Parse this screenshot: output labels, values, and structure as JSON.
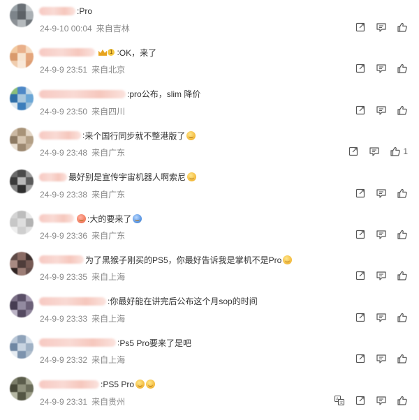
{
  "comments": [
    {
      "name_width": 52,
      "sep": ":",
      "text": "Pro",
      "emojis": 0,
      "badge": null,
      "date": "24-9-10 00:04",
      "location": "来自吉林",
      "likes": "",
      "translate": false,
      "avatar_colors": [
        "#9aa3a8",
        "#6a7076",
        "#c9cdd0",
        "#7d848a",
        "#5d6267",
        "#aab0b4",
        "#8b9095",
        "#b5babd",
        "#70767b"
      ]
    },
    {
      "name_width": 80,
      "sep": ":",
      "text": "OK，来了",
      "emojis": 0,
      "badge": {
        "level": "1"
      },
      "date": "24-9-9 23:51",
      "location": "来自北京",
      "likes": "",
      "translate": false,
      "avatar_colors": [
        "#f2c9a0",
        "#e9b08a",
        "#f6dcc2",
        "#d99a6c",
        "#f7e4cf",
        "#e4a57b",
        "#f0cdae",
        "#f9e8d8",
        "#de9e74"
      ]
    },
    {
      "name_width": 124,
      "sep": ":",
      "text": "pro公布，slim 降价",
      "emojis": 0,
      "badge": null,
      "date": "24-9-9 23:50",
      "location": "来自四川",
      "likes": "",
      "translate": false,
      "avatar_colors": [
        "#8bbf7a",
        "#4e88c7",
        "#c9dbe6",
        "#2f6fa8",
        "#a8c7dd",
        "#6aa6d6",
        "#dfe9ef",
        "#3b7dbb",
        "#9dc0da"
      ]
    },
    {
      "name_width": 60,
      "sep": ":",
      "text": "来个国行同步就不整港版了",
      "emojis": 1,
      "badge": null,
      "date": "24-9-9 23:48",
      "location": "来自广东",
      "likes": "1",
      "translate": false,
      "avatar_colors": [
        "#cbb9a3",
        "#a89378",
        "#e3d6c6",
        "#8d7a63",
        "#d7c6b1",
        "#b39f85",
        "#e9dfd2",
        "#9c8870",
        "#c4b19a"
      ]
    },
    {
      "name_width": 40,
      "sep": "",
      "text": "最好别是宣传宇宙机器人啊索尼",
      "emojis": 1,
      "badge": null,
      "date": "24-9-9 23:38",
      "location": "来自广东",
      "likes": "",
      "translate": false,
      "avatar_colors": [
        "#6b6b6b",
        "#4a4a4a",
        "#9a9a9a",
        "#3b3b3b",
        "#b8b8b8",
        "#5a5a5a",
        "#858585",
        "#2e2e2e",
        "#a3a3a3"
      ]
    },
    {
      "name_width": 50,
      "sep": "",
      "text": ":大的要来了",
      "emojis": 1,
      "badge": null,
      "date": "24-9-9 23:36",
      "location": "来自广东",
      "likes": "",
      "translate": false,
      "pre_emoji": true,
      "avatar_colors": [
        "#d4d4d4",
        "#bdbdbd",
        "#e9e9e9",
        "#c7c7c7",
        "#dedede",
        "#b3b3b3",
        "#efefef",
        "#cfcfcf",
        "#e2e2e2"
      ]
    },
    {
      "name_width": 64,
      "sep": "",
      "text": "为了黑猴子刚买的PS5，你最好告诉我是掌机不是Pro",
      "emojis": 1,
      "badge": null,
      "date": "24-9-9 23:35",
      "location": "来自上海",
      "likes": "",
      "translate": false,
      "avatar_colors": [
        "#5e4a47",
        "#8a6b64",
        "#3d2f2d",
        "#a88a82",
        "#4f3d3a",
        "#765a54",
        "#2f2422",
        "#9c7d75",
        "#644e4a"
      ]
    },
    {
      "name_width": 96,
      "sep": ":",
      "text": "你最好能在讲完后公布这个月sop的时间",
      "emojis": 0,
      "badge": null,
      "date": "24-9-9 23:33",
      "location": "来自上海",
      "likes": "",
      "translate": false,
      "avatar_colors": [
        "#7a6f86",
        "#5a4f67",
        "#a79cb3",
        "#463d52",
        "#928aa0",
        "#6b6078",
        "#bcb4c6",
        "#554a61",
        "#8d8299"
      ]
    },
    {
      "name_width": 110,
      "sep": ":",
      "text": "Ps5 Pro要来了是吧",
      "emojis": 0,
      "badge": null,
      "date": "24-9-9 23:32",
      "location": "来自上海",
      "likes": "",
      "translate": false,
      "avatar_colors": [
        "#b8c6d6",
        "#8fa3ba",
        "#d9e2ec",
        "#6f87a3",
        "#c8d4e1",
        "#9fb1c5",
        "#e6ecf2",
        "#7d93ad",
        "#aebdcc"
      ]
    },
    {
      "name_width": 86,
      "sep": ":",
      "text": "PS5 Pro",
      "emojis": 2,
      "badge": null,
      "date": "24-9-9 23:31",
      "location": "来自贵州",
      "likes": "",
      "translate": true,
      "avatar_colors": [
        "#7c7e6a",
        "#5b5d4b",
        "#a3a590",
        "#474838",
        "#8f917c",
        "#6a6c59",
        "#b5b7a3",
        "#545644",
        "#9a9c86"
      ]
    }
  ]
}
